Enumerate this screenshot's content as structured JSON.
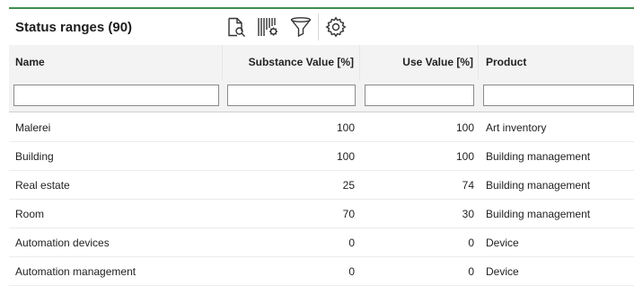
{
  "panel": {
    "title": "Status ranges (90)",
    "accent_color": "#3f8d4e"
  },
  "toolbar": {
    "items": [
      {
        "icon": "document-search-icon"
      },
      {
        "icon": "barcode-settings-icon"
      },
      {
        "icon": "filter-icon"
      },
      {
        "icon": "gear-icon"
      }
    ]
  },
  "table": {
    "columns": {
      "name": "Name",
      "substance": "Substance Value [%]",
      "use": "Use Value [%]",
      "product": "Product"
    },
    "rows": [
      {
        "name": "Malerei",
        "substance": "100",
        "use": "100",
        "product": "Art inventory"
      },
      {
        "name": "Building",
        "substance": "100",
        "use": "100",
        "product": "Building management"
      },
      {
        "name": "Real estate",
        "substance": "25",
        "use": "74",
        "product": "Building management"
      },
      {
        "name": "Room",
        "substance": "70",
        "use": "30",
        "product": "Building management"
      },
      {
        "name": "Automation devices",
        "substance": "0",
        "use": "0",
        "product": "Device"
      },
      {
        "name": "Automation management",
        "substance": "0",
        "use": "0",
        "product": "Device"
      }
    ]
  }
}
